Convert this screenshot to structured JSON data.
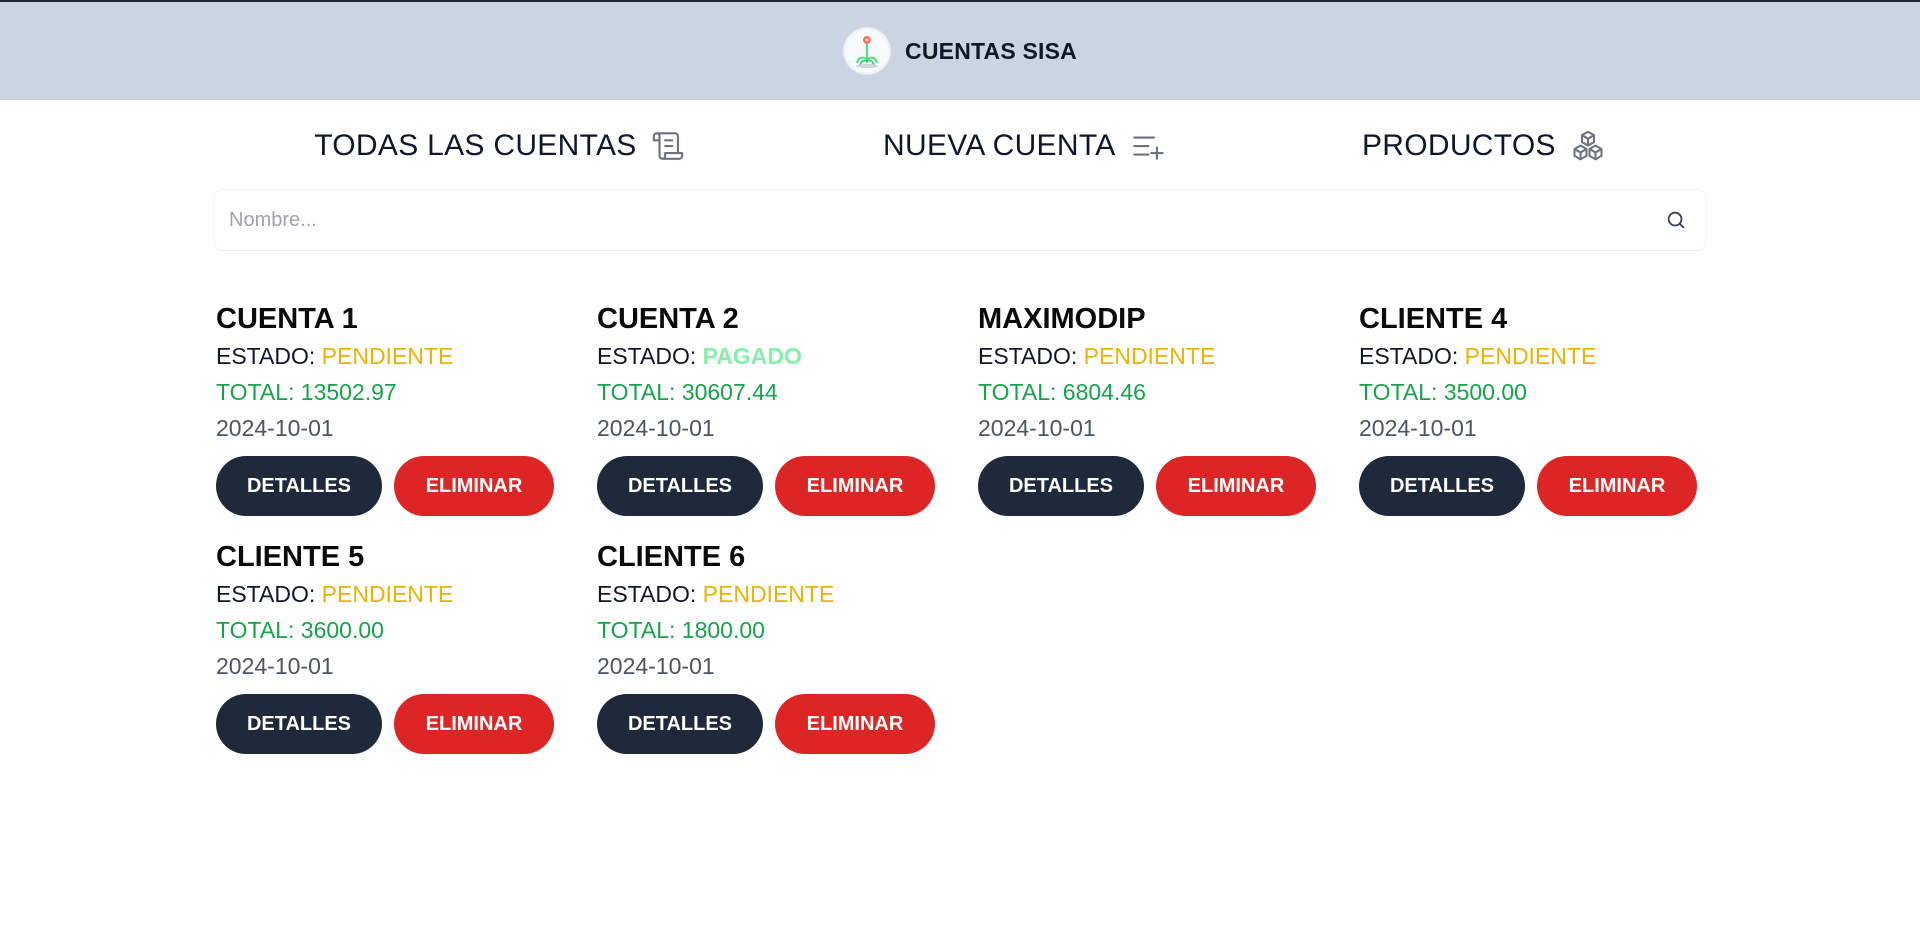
{
  "header": {
    "title": "CUENTAS SISA",
    "logo_icon": "flower-logo"
  },
  "nav": [
    {
      "label": "TODAS LAS CUENTAS",
      "icon": "scroll-icon"
    },
    {
      "label": "NUEVA CUENTA",
      "icon": "list-plus-icon"
    },
    {
      "label": "PRODUCTOS",
      "icon": "boxes-icon"
    }
  ],
  "search": {
    "placeholder": "Nombre...",
    "value": "",
    "icon": "search-icon"
  },
  "labels": {
    "estado": "ESTADO: ",
    "details_button": "DETALLES",
    "delete_button": "ELIMINAR"
  },
  "colors": {
    "header_bg": "#cbd5e1",
    "pending": "#eab308",
    "paid": "#86efac",
    "total": "#16a34a",
    "details_btn": "#1e293b",
    "delete_btn": "#dc2626"
  },
  "accounts": [
    {
      "name": "CUENTA 1",
      "status": "PENDIENTE",
      "total": "TOTAL: 13502.97",
      "date": "2024-10-01"
    },
    {
      "name": "CUENTA 2",
      "status": "PAGADO",
      "total": "TOTAL: 30607.44",
      "date": "2024-10-01"
    },
    {
      "name": "MAXIMODIP",
      "status": "PENDIENTE",
      "total": "TOTAL: 6804.46",
      "date": "2024-10-01"
    },
    {
      "name": "CLIENTE 4",
      "status": "PENDIENTE",
      "total": "TOTAL: 3500.00",
      "date": "2024-10-01"
    },
    {
      "name": "CLIENTE 5",
      "status": "PENDIENTE",
      "total": "TOTAL: 3600.00",
      "date": "2024-10-01"
    },
    {
      "name": "CLIENTE 6",
      "status": "PENDIENTE",
      "total": "TOTAL: 1800.00",
      "date": "2024-10-01"
    }
  ]
}
